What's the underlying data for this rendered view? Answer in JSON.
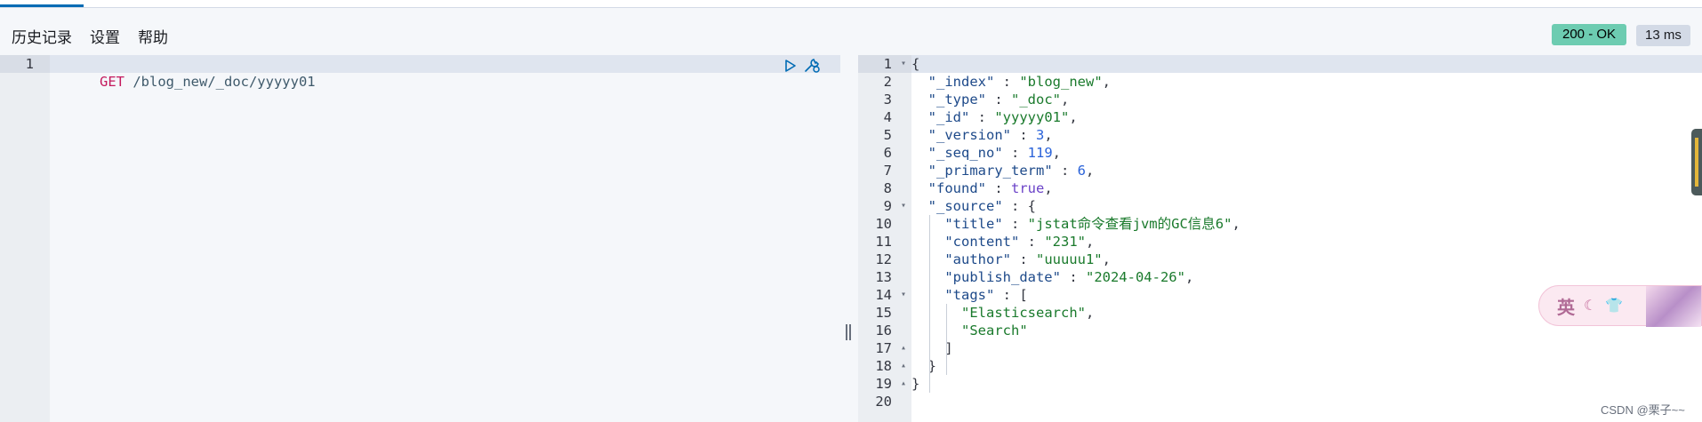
{
  "menu": {
    "history": "历史记录",
    "settings": "设置",
    "help": "帮助"
  },
  "response_meta": {
    "status": "200 - OK",
    "time": "13 ms"
  },
  "request_editor": {
    "line_numbers": [
      "1"
    ],
    "method": "GET",
    "path": " /blog_new/_doc/yyyyy01"
  },
  "response_editor": {
    "line_numbers": [
      "1",
      "2",
      "3",
      "4",
      "5",
      "6",
      "7",
      "8",
      "9",
      "10",
      "11",
      "12",
      "13",
      "14",
      "15",
      "16",
      "17",
      "18",
      "19",
      "20"
    ],
    "fold_markers": [
      "▾",
      "",
      "",
      "",
      "",
      "",
      "",
      "",
      "▾",
      "",
      "",
      "",
      "",
      "▾",
      "",
      "",
      "▴",
      "▴",
      "▴",
      ""
    ],
    "fields": {
      "index_key": "\"_index\"",
      "index_val": "\"blog_new\"",
      "type_key": "\"_type\"",
      "type_val": "\"_doc\"",
      "id_key": "\"_id\"",
      "id_val": "\"yyyyy01\"",
      "version_key": "\"_version\"",
      "version_val": "3",
      "seq_key": "\"_seq_no\"",
      "seq_val": "119",
      "term_key": "\"_primary_term\"",
      "term_val": "6",
      "found_key": "\"found\"",
      "found_val": "true",
      "source_key": "\"_source\"",
      "title_key": "\"title\"",
      "title_val": "\"jstat命令查看jvm的GC信息6\"",
      "content_key": "\"content\"",
      "content_val": "\"231\"",
      "author_key": "\"author\"",
      "author_val": "\"uuuuu1\"",
      "date_key": "\"publish_date\"",
      "date_val": "\"2024-04-26\"",
      "tags_key": "\"tags\"",
      "tag1": "\"Elasticsearch\"",
      "tag2": "\"Search\""
    }
  },
  "ime": {
    "label": "英"
  },
  "watermark": "CSDN @栗子~~",
  "icons": [
    "play-icon",
    "wrench-icon"
  ],
  "colors": {
    "status_ok": "#6dccb1",
    "accent": "#006bb4"
  }
}
